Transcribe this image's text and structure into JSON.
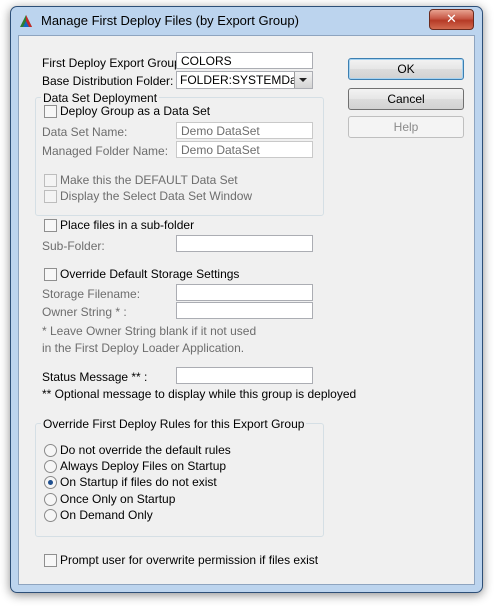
{
  "window": {
    "title": "Manage First Deploy Files (by Export Group)",
    "close_label": "✕",
    "icon": "app-triangle-icon"
  },
  "fields": {
    "export_group_label": "First Deploy Export Group:",
    "export_group_value": "COLORS",
    "base_folder_label": "Base Distribution Folder:",
    "base_folder_value": "FOLDER:SYSTEMData"
  },
  "dataset": {
    "group_title": "Data Set Deployment",
    "deploy_as_dataset_label": "Deploy Group as a Data Set",
    "deploy_as_dataset_checked": false,
    "name_label": "Data Set Name:",
    "name_value": "Demo DataSet",
    "folder_label": "Managed Folder Name:",
    "folder_value": "Demo DataSet",
    "default_label": "Make this the DEFAULT Data Set",
    "default_checked": false,
    "select_window_label": "Display the Select Data Set Window",
    "select_window_checked": false
  },
  "subfolder": {
    "place_label": "Place files in a sub-folder",
    "place_checked": false,
    "label": "Sub-Folder:",
    "value": ""
  },
  "storage": {
    "override_label": "Override Default Storage Settings",
    "override_checked": false,
    "filename_label": "Storage Filename:",
    "filename_value": "",
    "owner_label": "Owner String * :",
    "owner_value": "",
    "note_line1": "* Leave Owner String blank if it not used",
    "note_line2": "in the First Deploy Loader Application."
  },
  "status": {
    "label": "Status Message ** :",
    "value": "",
    "note": "** Optional message to display while this group is deployed"
  },
  "rules": {
    "group_title": "Override First Deploy Rules for this Export Group",
    "options": [
      "Do not override the default rules",
      "Always Deploy Files on Startup",
      "On Startup if files do not exist",
      "Once Only on Startup",
      "On Demand Only"
    ],
    "selected": "On Startup if files do not exist"
  },
  "prompt": {
    "label": "Prompt user for overwrite permission if files exist",
    "checked": false
  },
  "buttons": {
    "ok": "OK",
    "cancel": "Cancel",
    "help": "Help"
  }
}
